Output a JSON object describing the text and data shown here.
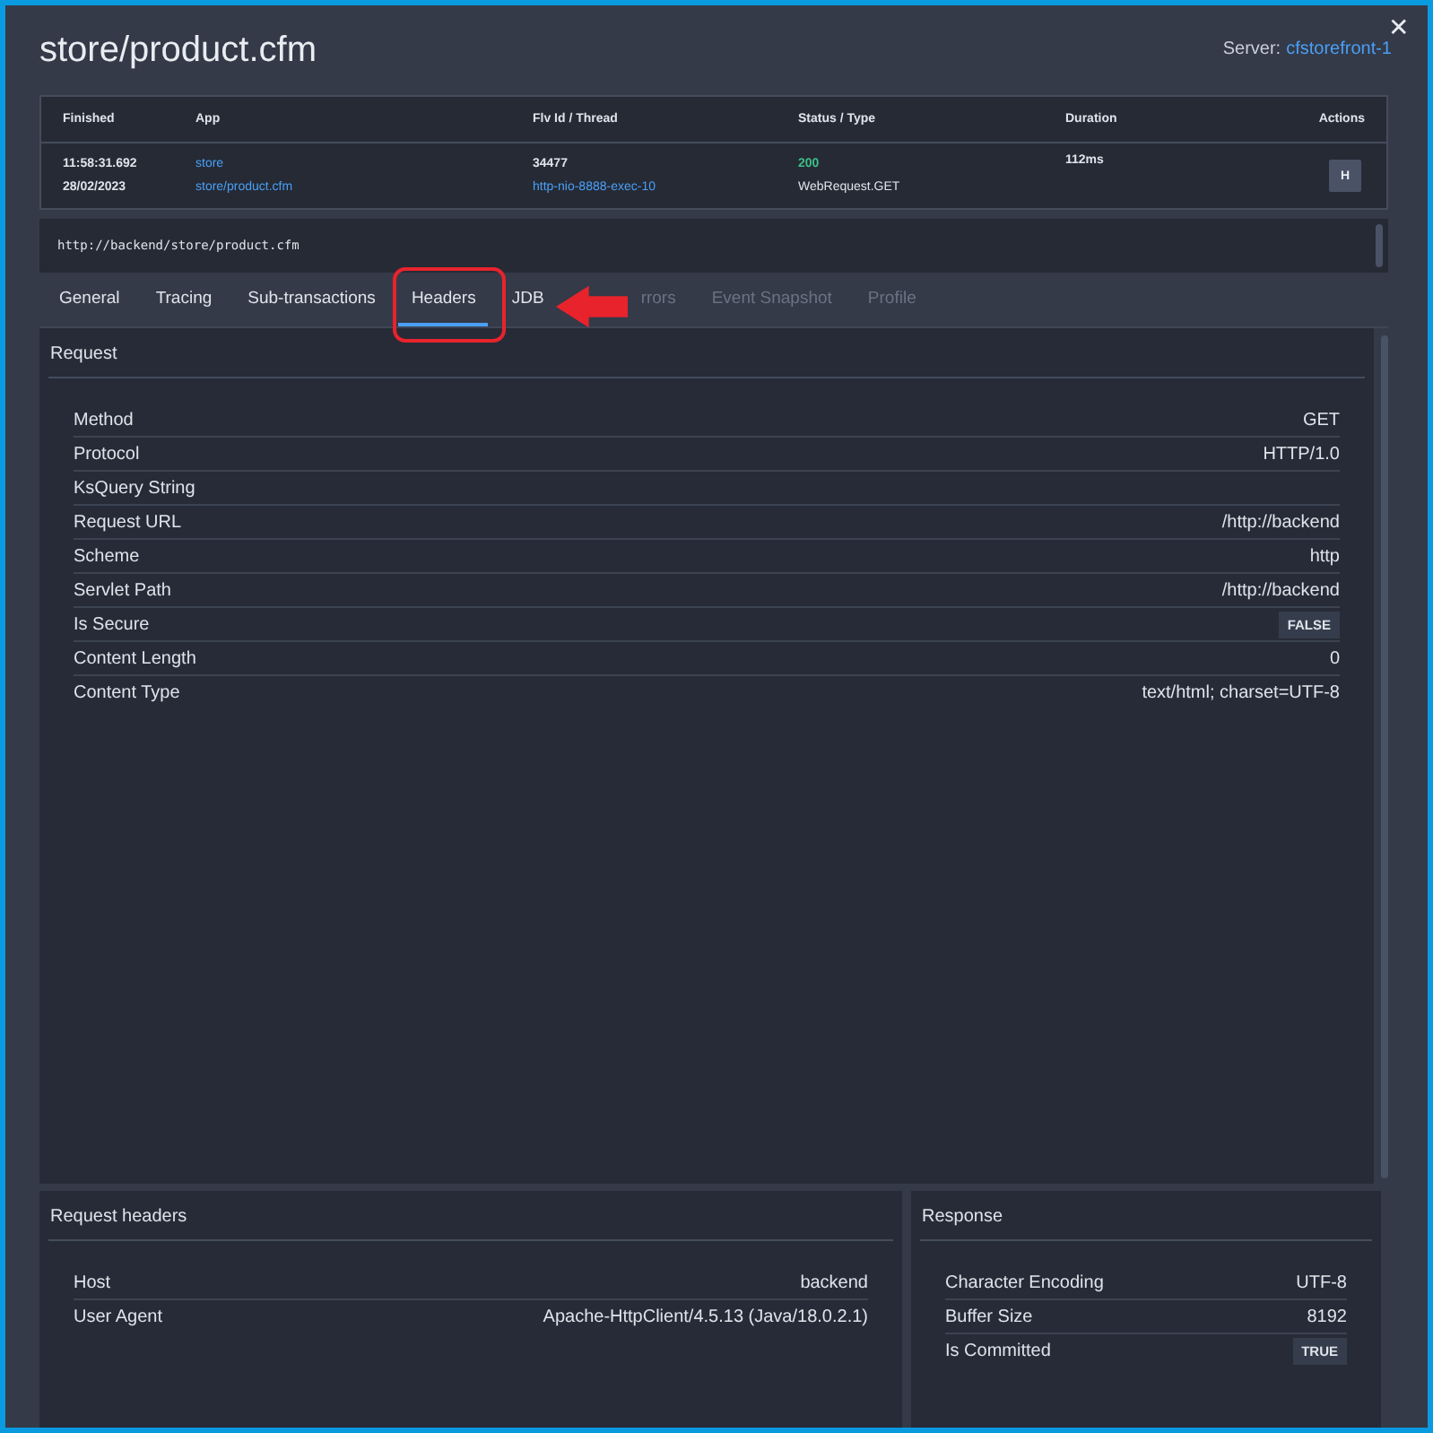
{
  "window": {
    "title": "store/product.cfm",
    "close": "✕"
  },
  "server": {
    "label": "Server:",
    "name": "cfstorefront-1"
  },
  "transaction": {
    "columns": [
      "Finished",
      "App",
      "Flv Id / Thread",
      "Status / Type",
      "Duration",
      "Actions"
    ],
    "finished": [
      "11:58:31.692",
      "28/02/2023"
    ],
    "app": [
      "store",
      "store/product.cfm"
    ],
    "thread": [
      "34477",
      "http-nio-8888-exec-10"
    ],
    "status": "200",
    "type": "WebRequest.GET",
    "duration": "112ms",
    "action": "H"
  },
  "url": "http://backend/store/product.cfm",
  "tabs": [
    {
      "label": "General",
      "selected": false,
      "disabled": false
    },
    {
      "label": "Tracing",
      "selected": false,
      "disabled": false
    },
    {
      "label": "Sub-transactions",
      "selected": false,
      "disabled": false
    },
    {
      "label": "Headers",
      "selected": true,
      "disabled": false
    },
    {
      "label": "JDB",
      "selected": false,
      "disabled": false
    },
    {
      "label": "rrors",
      "selected": false,
      "disabled": true
    },
    {
      "label": "Event Snapshot",
      "selected": false,
      "disabled": true
    },
    {
      "label": "Profile",
      "selected": false,
      "disabled": true
    }
  ],
  "request": {
    "title": "Request",
    "rows": [
      {
        "label": "Method",
        "value": "GET",
        "kind": "text"
      },
      {
        "label": "Protocol",
        "value": "HTTP/1.0",
        "kind": "text"
      },
      {
        "label": "KsQuery String",
        "kind": "text"
      },
      {
        "label": "Request URL",
        "value": "/http://backend",
        "kind": "text"
      },
      {
        "label": "Scheme",
        "value": "http",
        "kind": "text"
      },
      {
        "label": "Servlet Path",
        "value": "/http://backend",
        "kind": "text"
      },
      {
        "label": "Is Secure",
        "value": "FALSE",
        "kind": "badge"
      },
      {
        "label": "Content Length",
        "value": "0",
        "kind": "text"
      },
      {
        "label": "Content Type",
        "value": "text/html; charset=UTF-8",
        "kind": "text"
      }
    ]
  },
  "request_headers": {
    "title": "Request headers",
    "rows": [
      {
        "label": "Host",
        "value": "backend",
        "kind": "text"
      },
      {
        "label": "User Agent",
        "value": "Apache-HttpClient/4.5.13 (Java/18.0.2.1)",
        "kind": "text"
      }
    ]
  },
  "response": {
    "title": "Response",
    "rows": [
      {
        "label": "Character Encoding",
        "value": "UTF-8",
        "kind": "text"
      },
      {
        "label": "Buffer Size",
        "value": "8192",
        "kind": "text"
      },
      {
        "label": "Is Committed",
        "value": "TRUE",
        "kind": "badge"
      }
    ]
  }
}
